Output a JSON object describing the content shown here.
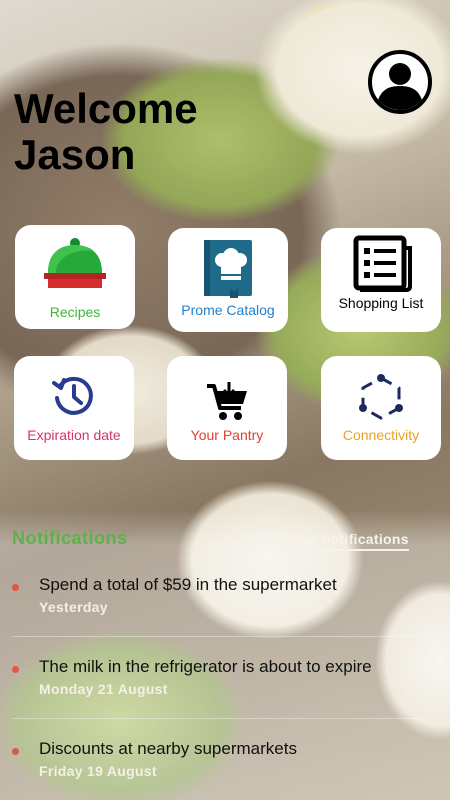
{
  "header": {
    "welcome_text": "Welcome Jason"
  },
  "tiles": [
    {
      "label": "Recipes",
      "icon": "cloche-icon",
      "color": "#3fb43a"
    },
    {
      "label": "Prome Catalog",
      "icon": "chef-book-icon",
      "color": "#1f7fd1"
    },
    {
      "label": "Shopping List",
      "icon": "newspaper-list-icon",
      "color": "#000000"
    },
    {
      "label": "Expiration date",
      "icon": "history-clock-icon",
      "color": "#d6336a"
    },
    {
      "label": "Your Pantry",
      "icon": "shopping-cart-icon",
      "color": "#e0402d"
    },
    {
      "label": "Connectivity",
      "icon": "hexagon-network-icon",
      "color": "#eea020"
    }
  ],
  "notifications": {
    "title": "Notifications",
    "clear_label": "Clear notifications",
    "items": [
      {
        "message": "Spend a total of $59 in the supermarket",
        "date": "Yesterday"
      },
      {
        "message": "The milk in the refrigerator is about to expire",
        "date": "Monday 21 August"
      },
      {
        "message": "Discounts at nearby supermarkets",
        "date": "Friday 19 August"
      }
    ]
  },
  "colors": {
    "accent_green": "#5fb04a",
    "bullet_red": "#e2554a"
  }
}
